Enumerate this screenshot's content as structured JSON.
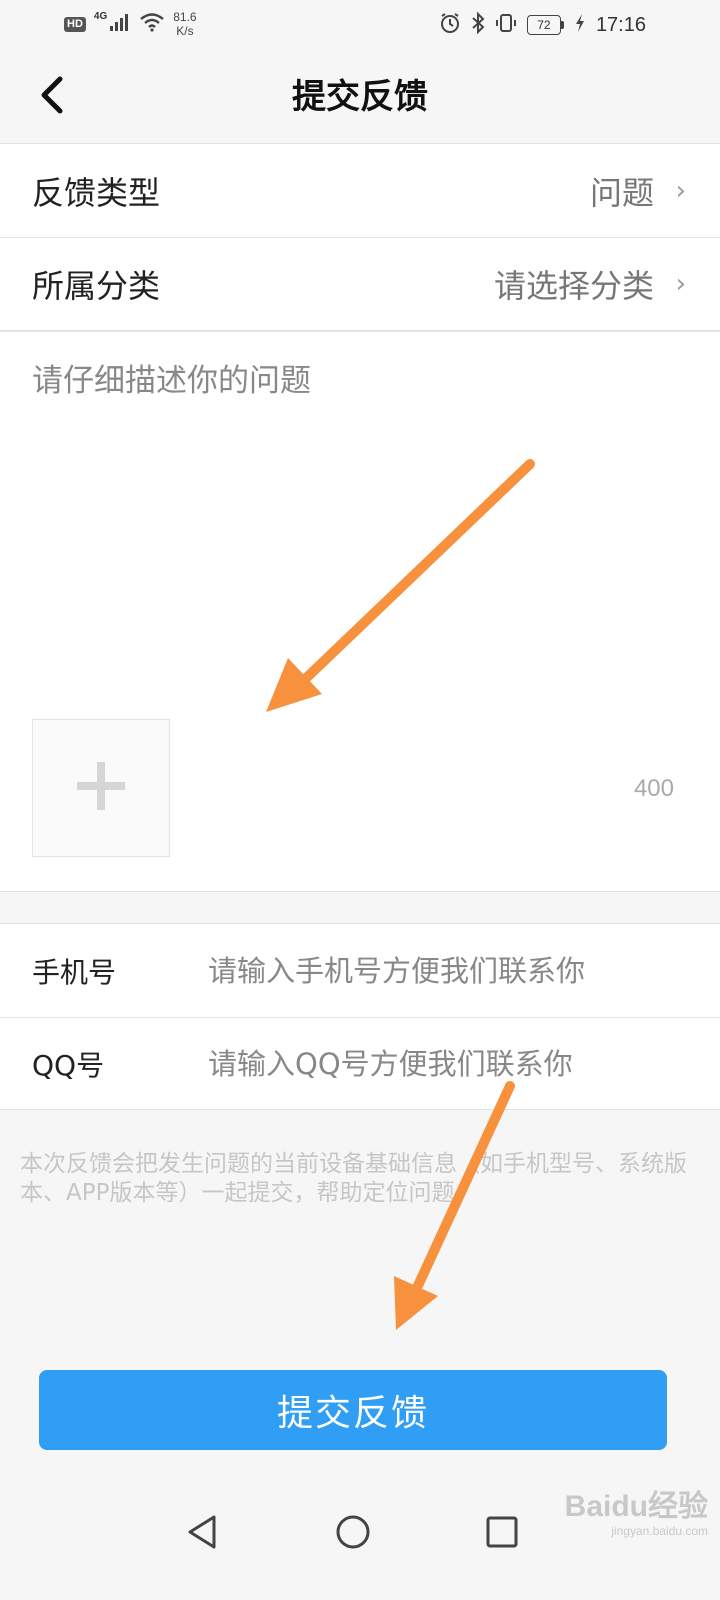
{
  "status_bar": {
    "hd": "HD",
    "network": "4G",
    "speed_value": "81.6",
    "speed_unit": "K/s",
    "battery": "72",
    "time": "17:16"
  },
  "header": {
    "title": "提交反馈"
  },
  "form": {
    "feedback_type": {
      "label": "反馈类型",
      "value": "问题"
    },
    "category": {
      "label": "所属分类",
      "value": "请选择分类"
    },
    "description": {
      "placeholder": "请仔细描述你的问题",
      "char_limit": "400"
    }
  },
  "contact": {
    "phone": {
      "label": "手机号",
      "placeholder": "请输入手机号方便我们联系你"
    },
    "qq": {
      "label": "QQ号",
      "placeholder": "请输入QQ号方便我们联系你"
    }
  },
  "notice": "本次反馈会把发生问题的当前设备基础信息（如手机型号、系统版本、APP版本等）一起提交，帮助定位问题。",
  "submit_label": "提交反馈",
  "watermark": {
    "logo": "Baidu经验",
    "url": "jingyan.baidu.com"
  },
  "colors": {
    "accent": "#2f9ef4",
    "annotation_arrow": "#f7913d"
  },
  "icons": {
    "back": "back-arrow-icon",
    "add_image": "plus-icon",
    "nav_back": "triangle-back-icon",
    "nav_home": "circle-home-icon",
    "nav_recent": "square-recent-icon"
  }
}
